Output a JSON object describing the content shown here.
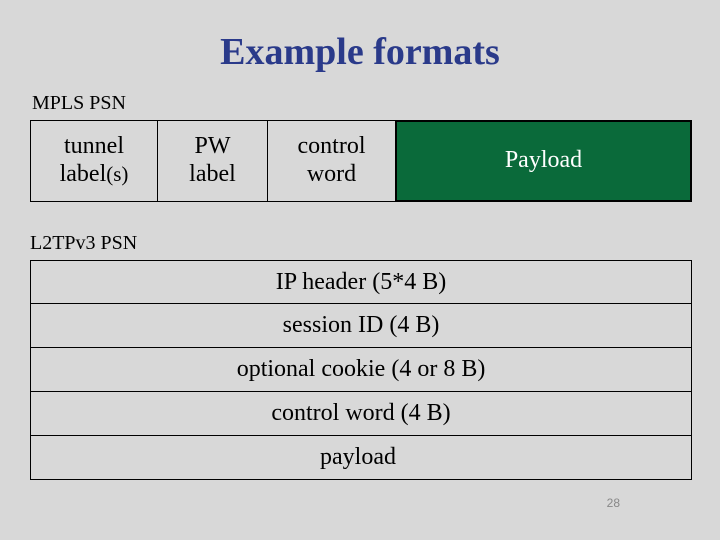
{
  "title": "Example formats",
  "sections": {
    "mpls_label": "MPLS PSN",
    "l2tp_label": "L2TPv3 PSN"
  },
  "mpls_row": {
    "tunnel_line1": "tunnel",
    "tunnel_line2_prefix": "label",
    "tunnel_line2_sub": "(s)",
    "pw_line1": "PW",
    "pw_line2": "label",
    "ctrl_line1": "control",
    "ctrl_line2": "word",
    "payload": "Payload"
  },
  "l2tp_rows": [
    {
      "text": "IP header",
      "annot": "(5*4 B)"
    },
    {
      "text": "session ID",
      "annot": "(4 B)"
    },
    {
      "text": "optional cookie",
      "annot": "(4 or 8 B)"
    },
    {
      "text": "control word",
      "annot": "(4 B)"
    },
    {
      "text": "payload",
      "annot": ""
    }
  ],
  "page_number": "28"
}
